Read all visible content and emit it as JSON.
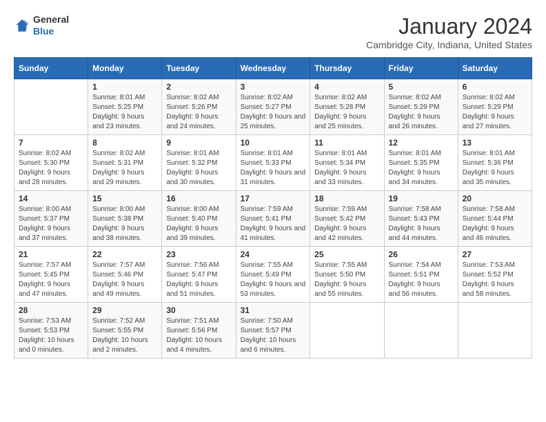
{
  "logo": {
    "general": "General",
    "blue": "Blue"
  },
  "title": "January 2024",
  "location": "Cambridge City, Indiana, United States",
  "days_of_week": [
    "Sunday",
    "Monday",
    "Tuesday",
    "Wednesday",
    "Thursday",
    "Friday",
    "Saturday"
  ],
  "weeks": [
    [
      {
        "day": "",
        "sunrise": "",
        "sunset": "",
        "daylight": ""
      },
      {
        "day": "1",
        "sunrise": "Sunrise: 8:01 AM",
        "sunset": "Sunset: 5:25 PM",
        "daylight": "Daylight: 9 hours and 23 minutes."
      },
      {
        "day": "2",
        "sunrise": "Sunrise: 8:02 AM",
        "sunset": "Sunset: 5:26 PM",
        "daylight": "Daylight: 9 hours and 24 minutes."
      },
      {
        "day": "3",
        "sunrise": "Sunrise: 8:02 AM",
        "sunset": "Sunset: 5:27 PM",
        "daylight": "Daylight: 9 hours and 25 minutes."
      },
      {
        "day": "4",
        "sunrise": "Sunrise: 8:02 AM",
        "sunset": "Sunset: 5:28 PM",
        "daylight": "Daylight: 9 hours and 25 minutes."
      },
      {
        "day": "5",
        "sunrise": "Sunrise: 8:02 AM",
        "sunset": "Sunset: 5:29 PM",
        "daylight": "Daylight: 9 hours and 26 minutes."
      },
      {
        "day": "6",
        "sunrise": "Sunrise: 8:02 AM",
        "sunset": "Sunset: 5:29 PM",
        "daylight": "Daylight: 9 hours and 27 minutes."
      }
    ],
    [
      {
        "day": "7",
        "sunrise": "Sunrise: 8:02 AM",
        "sunset": "Sunset: 5:30 PM",
        "daylight": "Daylight: 9 hours and 28 minutes."
      },
      {
        "day": "8",
        "sunrise": "Sunrise: 8:02 AM",
        "sunset": "Sunset: 5:31 PM",
        "daylight": "Daylight: 9 hours and 29 minutes."
      },
      {
        "day": "9",
        "sunrise": "Sunrise: 8:01 AM",
        "sunset": "Sunset: 5:32 PM",
        "daylight": "Daylight: 9 hours and 30 minutes."
      },
      {
        "day": "10",
        "sunrise": "Sunrise: 8:01 AM",
        "sunset": "Sunset: 5:33 PM",
        "daylight": "Daylight: 9 hours and 31 minutes."
      },
      {
        "day": "11",
        "sunrise": "Sunrise: 8:01 AM",
        "sunset": "Sunset: 5:34 PM",
        "daylight": "Daylight: 9 hours and 33 minutes."
      },
      {
        "day": "12",
        "sunrise": "Sunrise: 8:01 AM",
        "sunset": "Sunset: 5:35 PM",
        "daylight": "Daylight: 9 hours and 34 minutes."
      },
      {
        "day": "13",
        "sunrise": "Sunrise: 8:01 AM",
        "sunset": "Sunset: 5:36 PM",
        "daylight": "Daylight: 9 hours and 35 minutes."
      }
    ],
    [
      {
        "day": "14",
        "sunrise": "Sunrise: 8:00 AM",
        "sunset": "Sunset: 5:37 PM",
        "daylight": "Daylight: 9 hours and 37 minutes."
      },
      {
        "day": "15",
        "sunrise": "Sunrise: 8:00 AM",
        "sunset": "Sunset: 5:38 PM",
        "daylight": "Daylight: 9 hours and 38 minutes."
      },
      {
        "day": "16",
        "sunrise": "Sunrise: 8:00 AM",
        "sunset": "Sunset: 5:40 PM",
        "daylight": "Daylight: 9 hours and 39 minutes."
      },
      {
        "day": "17",
        "sunrise": "Sunrise: 7:59 AM",
        "sunset": "Sunset: 5:41 PM",
        "daylight": "Daylight: 9 hours and 41 minutes."
      },
      {
        "day": "18",
        "sunrise": "Sunrise: 7:59 AM",
        "sunset": "Sunset: 5:42 PM",
        "daylight": "Daylight: 9 hours and 42 minutes."
      },
      {
        "day": "19",
        "sunrise": "Sunrise: 7:58 AM",
        "sunset": "Sunset: 5:43 PM",
        "daylight": "Daylight: 9 hours and 44 minutes."
      },
      {
        "day": "20",
        "sunrise": "Sunrise: 7:58 AM",
        "sunset": "Sunset: 5:44 PM",
        "daylight": "Daylight: 9 hours and 46 minutes."
      }
    ],
    [
      {
        "day": "21",
        "sunrise": "Sunrise: 7:57 AM",
        "sunset": "Sunset: 5:45 PM",
        "daylight": "Daylight: 9 hours and 47 minutes."
      },
      {
        "day": "22",
        "sunrise": "Sunrise: 7:57 AM",
        "sunset": "Sunset: 5:46 PM",
        "daylight": "Daylight: 9 hours and 49 minutes."
      },
      {
        "day": "23",
        "sunrise": "Sunrise: 7:56 AM",
        "sunset": "Sunset: 5:47 PM",
        "daylight": "Daylight: 9 hours and 51 minutes."
      },
      {
        "day": "24",
        "sunrise": "Sunrise: 7:55 AM",
        "sunset": "Sunset: 5:49 PM",
        "daylight": "Daylight: 9 hours and 53 minutes."
      },
      {
        "day": "25",
        "sunrise": "Sunrise: 7:55 AM",
        "sunset": "Sunset: 5:50 PM",
        "daylight": "Daylight: 9 hours and 55 minutes."
      },
      {
        "day": "26",
        "sunrise": "Sunrise: 7:54 AM",
        "sunset": "Sunset: 5:51 PM",
        "daylight": "Daylight: 9 hours and 56 minutes."
      },
      {
        "day": "27",
        "sunrise": "Sunrise: 7:53 AM",
        "sunset": "Sunset: 5:52 PM",
        "daylight": "Daylight: 9 hours and 58 minutes."
      }
    ],
    [
      {
        "day": "28",
        "sunrise": "Sunrise: 7:53 AM",
        "sunset": "Sunset: 5:53 PM",
        "daylight": "Daylight: 10 hours and 0 minutes."
      },
      {
        "day": "29",
        "sunrise": "Sunrise: 7:52 AM",
        "sunset": "Sunset: 5:55 PM",
        "daylight": "Daylight: 10 hours and 2 minutes."
      },
      {
        "day": "30",
        "sunrise": "Sunrise: 7:51 AM",
        "sunset": "Sunset: 5:56 PM",
        "daylight": "Daylight: 10 hours and 4 minutes."
      },
      {
        "day": "31",
        "sunrise": "Sunrise: 7:50 AM",
        "sunset": "Sunset: 5:57 PM",
        "daylight": "Daylight: 10 hours and 6 minutes."
      },
      {
        "day": "",
        "sunrise": "",
        "sunset": "",
        "daylight": ""
      },
      {
        "day": "",
        "sunrise": "",
        "sunset": "",
        "daylight": ""
      },
      {
        "day": "",
        "sunrise": "",
        "sunset": "",
        "daylight": ""
      }
    ]
  ]
}
